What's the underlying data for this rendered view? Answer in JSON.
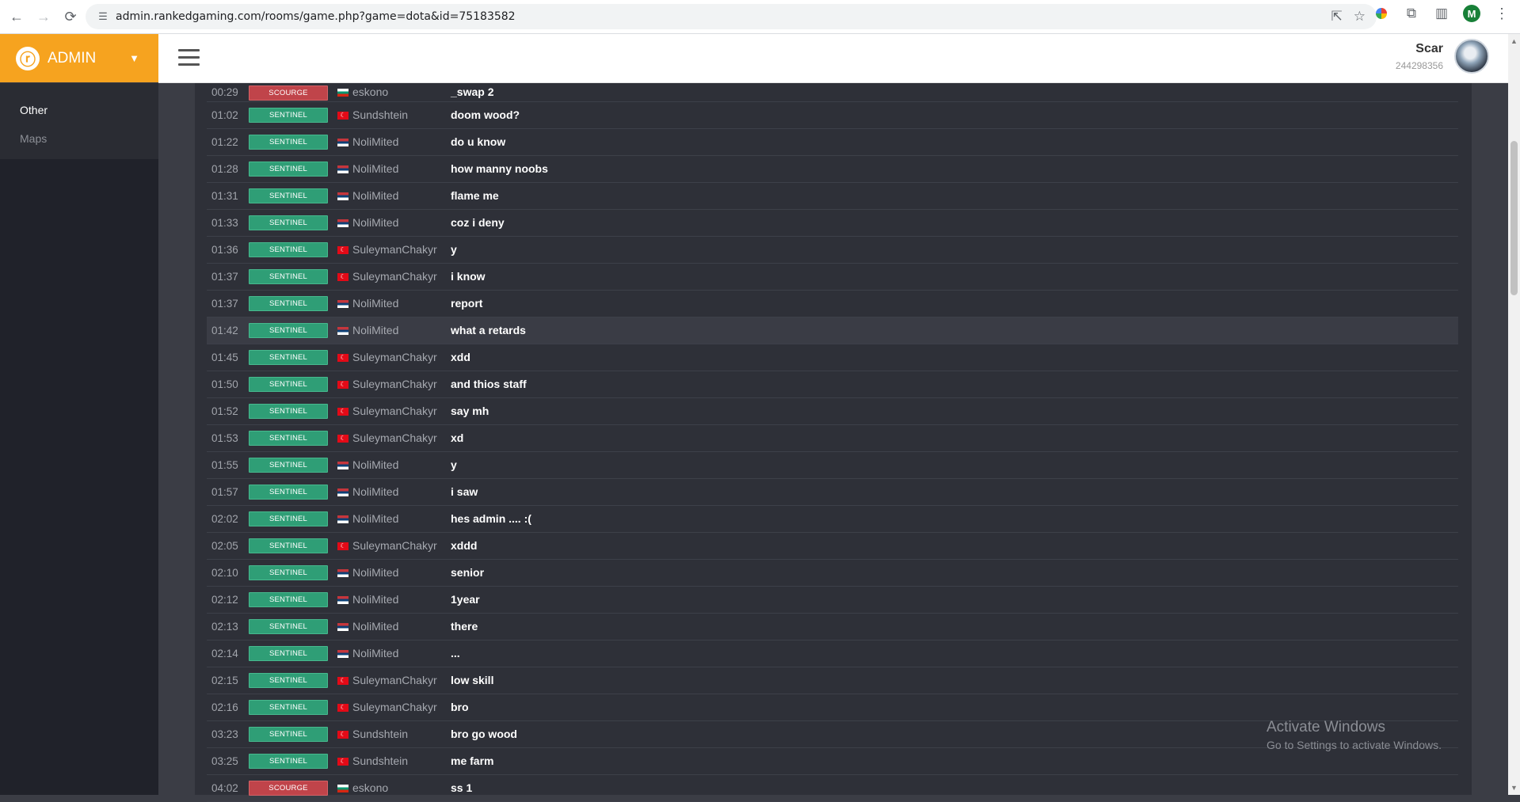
{
  "browser": {
    "url": "admin.rankedgaming.com/rooms/game.php?game=dota&id=75183582",
    "profile_initial": "M",
    "icons": {
      "back": "←",
      "forward": "→",
      "reload": "⟳",
      "site_info": "☰",
      "share": "⇱",
      "bookmark": "☆",
      "extensions": "⧉",
      "sidebar": "▥",
      "menu": "⋮"
    }
  },
  "brand": {
    "logo_glyph": "ⓡ",
    "title": "ADMIN",
    "caret": "▼"
  },
  "header": {
    "user_name": "Scar",
    "user_id": "244298356"
  },
  "sidebar": {
    "items": [
      {
        "label": "Other"
      },
      {
        "label": "Maps"
      }
    ]
  },
  "chat": [
    {
      "time": "00:29",
      "team": "SCOURGE",
      "flag": "bg",
      "player": "eskono",
      "message": "_swap 2"
    },
    {
      "time": "01:02",
      "team": "SENTINEL",
      "flag": "tr",
      "player": "Sundshtein",
      "message": "doom wood?"
    },
    {
      "time": "01:22",
      "team": "SENTINEL",
      "flag": "rs",
      "player": "NoliMited",
      "message": "do u know"
    },
    {
      "time": "01:28",
      "team": "SENTINEL",
      "flag": "rs",
      "player": "NoliMited",
      "message": "how manny noobs"
    },
    {
      "time": "01:31",
      "team": "SENTINEL",
      "flag": "rs",
      "player": "NoliMited",
      "message": "flame me"
    },
    {
      "time": "01:33",
      "team": "SENTINEL",
      "flag": "rs",
      "player": "NoliMited",
      "message": "coz i deny"
    },
    {
      "time": "01:36",
      "team": "SENTINEL",
      "flag": "tr",
      "player": "SuleymanChakyr",
      "message": "y"
    },
    {
      "time": "01:37",
      "team": "SENTINEL",
      "flag": "tr",
      "player": "SuleymanChakyr",
      "message": "i know"
    },
    {
      "time": "01:37",
      "team": "SENTINEL",
      "flag": "rs",
      "player": "NoliMited",
      "message": "report"
    },
    {
      "time": "01:42",
      "team": "SENTINEL",
      "flag": "rs",
      "player": "NoliMited",
      "message": "what a retards"
    },
    {
      "time": "01:45",
      "team": "SENTINEL",
      "flag": "tr",
      "player": "SuleymanChakyr",
      "message": "xdd"
    },
    {
      "time": "01:50",
      "team": "SENTINEL",
      "flag": "tr",
      "player": "SuleymanChakyr",
      "message": "and thios staff"
    },
    {
      "time": "01:52",
      "team": "SENTINEL",
      "flag": "tr",
      "player": "SuleymanChakyr",
      "message": "say mh"
    },
    {
      "time": "01:53",
      "team": "SENTINEL",
      "flag": "tr",
      "player": "SuleymanChakyr",
      "message": "xd"
    },
    {
      "time": "01:55",
      "team": "SENTINEL",
      "flag": "rs",
      "player": "NoliMited",
      "message": "y"
    },
    {
      "time": "01:57",
      "team": "SENTINEL",
      "flag": "rs",
      "player": "NoliMited",
      "message": "i saw"
    },
    {
      "time": "02:02",
      "team": "SENTINEL",
      "flag": "rs",
      "player": "NoliMited",
      "message": "hes admin .... :("
    },
    {
      "time": "02:05",
      "team": "SENTINEL",
      "flag": "tr",
      "player": "SuleymanChakyr",
      "message": "xddd"
    },
    {
      "time": "02:10",
      "team": "SENTINEL",
      "flag": "rs",
      "player": "NoliMited",
      "message": "senior"
    },
    {
      "time": "02:12",
      "team": "SENTINEL",
      "flag": "rs",
      "player": "NoliMited",
      "message": "1year"
    },
    {
      "time": "02:13",
      "team": "SENTINEL",
      "flag": "rs",
      "player": "NoliMited",
      "message": "there"
    },
    {
      "time": "02:14",
      "team": "SENTINEL",
      "flag": "rs",
      "player": "NoliMited",
      "message": "..."
    },
    {
      "time": "02:15",
      "team": "SENTINEL",
      "flag": "tr",
      "player": "SuleymanChakyr",
      "message": "low skill"
    },
    {
      "time": "02:16",
      "team": "SENTINEL",
      "flag": "tr",
      "player": "SuleymanChakyr",
      "message": "bro"
    },
    {
      "time": "03:23",
      "team": "SENTINEL",
      "flag": "tr",
      "player": "Sundshtein",
      "message": "bro go wood"
    },
    {
      "time": "03:25",
      "team": "SENTINEL",
      "flag": "tr",
      "player": "Sundshtein",
      "message": "me farm"
    },
    {
      "time": "04:02",
      "team": "SCOURGE",
      "flag": "bg",
      "player": "eskono",
      "message": "ss 1"
    }
  ],
  "watermark": {
    "title": "Activate Windows",
    "subtitle": "Go to Settings to activate Windows."
  },
  "colors": {
    "brand": "#f6a31f",
    "sentinel": "#2f9e76",
    "scourge": "#c0444a",
    "sidebar_bg": "#20222a",
    "content_bg": "#2e3038"
  }
}
